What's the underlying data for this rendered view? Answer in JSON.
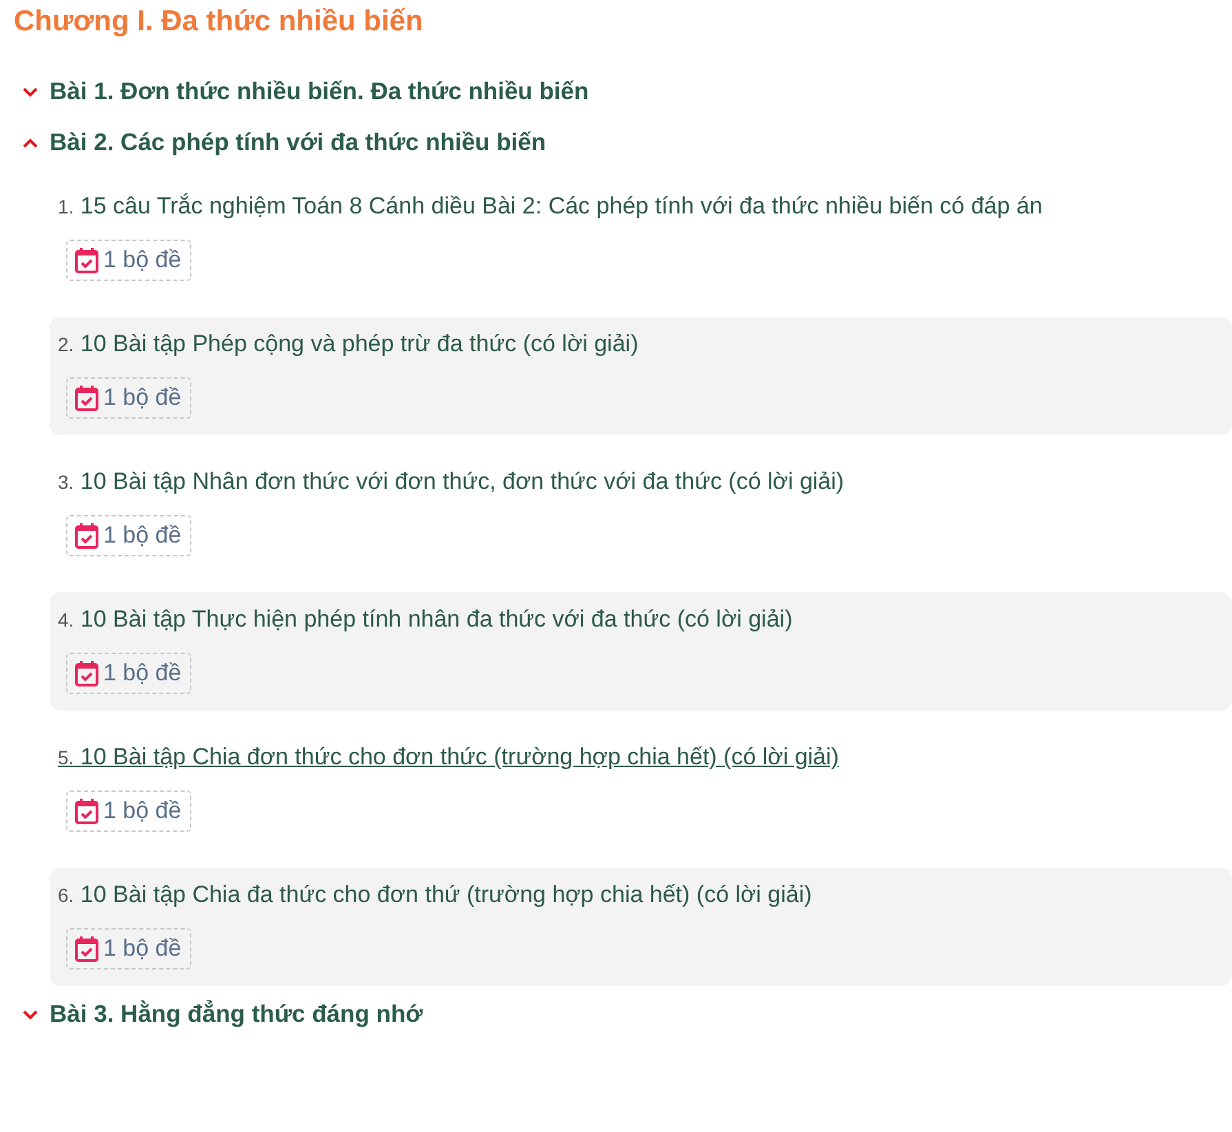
{
  "chapter": {
    "title": "Chương I. Đa thức nhiều biến"
  },
  "lessons": [
    {
      "title": "Bài 1. Đơn thức nhiều biến. Đa thức nhiều biến",
      "expanded": false
    },
    {
      "title": "Bài 2. Các phép tính với đa thức nhiều biến",
      "expanded": true,
      "items": [
        {
          "number": "1.",
          "title": "15 câu Trắc nghiệm Toán 8 Cánh diều Bài 2: Các phép tính với đa thức nhiều biến có đáp án",
          "badge": "1 bộ đề",
          "hovered": false
        },
        {
          "number": "2.",
          "title": "10 Bài tập Phép cộng và phép trừ đa thức (có lời giải)",
          "badge": "1 bộ đề",
          "hovered": false
        },
        {
          "number": "3.",
          "title": "10 Bài tập Nhân đơn thức với đơn thức, đơn thức với đa thức (có lời giải)",
          "badge": "1 bộ đề",
          "hovered": false
        },
        {
          "number": "4.",
          "title": "10 Bài tập Thực hiện phép tính nhân đa thức với đa thức (có lời giải)",
          "badge": "1 bộ đề",
          "hovered": false
        },
        {
          "number": "5.",
          "title": "10 Bài tập Chia đơn thức cho đơn thức (trường hợp chia hết) (có lời giải)",
          "badge": "1 bộ đề",
          "hovered": true
        },
        {
          "number": "6.",
          "title": "10 Bài tập Chia đa thức cho đơn thứ (trường hợp chia hết) (có lời giải)",
          "badge": "1 bộ đề",
          "hovered": false
        }
      ]
    },
    {
      "title": "Bài 3. Hằng đẳng thức đáng nhớ",
      "expanded": false
    }
  ]
}
